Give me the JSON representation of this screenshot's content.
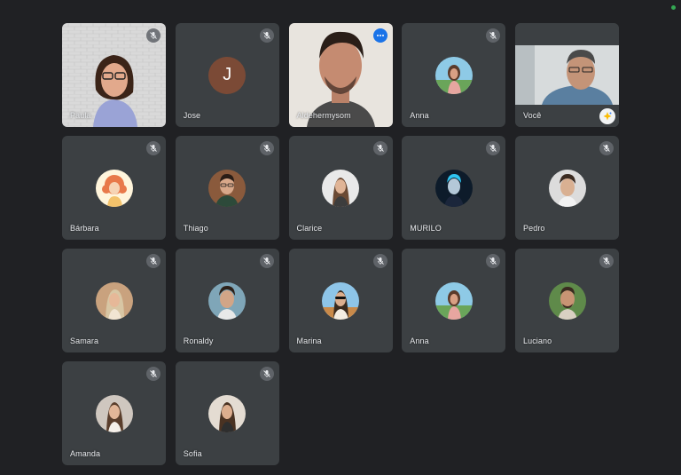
{
  "participants": [
    {
      "name": "Paula",
      "muted": true,
      "video": true
    },
    {
      "name": "Jose",
      "muted": true,
      "initial": "J"
    },
    {
      "name": "Aldehermysom",
      "muted": false,
      "video": true
    },
    {
      "name": "Anna",
      "muted": true
    },
    {
      "name": "Você",
      "muted": false,
      "video": true
    },
    {
      "name": "Bárbara",
      "muted": true
    },
    {
      "name": "Thiago",
      "muted": true
    },
    {
      "name": "Clarice",
      "muted": true
    },
    {
      "name": "MURILO",
      "muted": true
    },
    {
      "name": "Pedro",
      "muted": true
    },
    {
      "name": "Samara",
      "muted": true
    },
    {
      "name": "Ronaldy",
      "muted": true
    },
    {
      "name": "Marina",
      "muted": true
    },
    {
      "name": "Anna",
      "muted": true
    },
    {
      "name": "Luciano",
      "muted": true
    },
    {
      "name": "Amanda",
      "muted": true
    },
    {
      "name": "Sofia",
      "muted": true
    }
  ],
  "colors": {
    "background": "#202124",
    "tile": "#3c4043",
    "accent": "#1a73e8",
    "status": "#34a853"
  }
}
